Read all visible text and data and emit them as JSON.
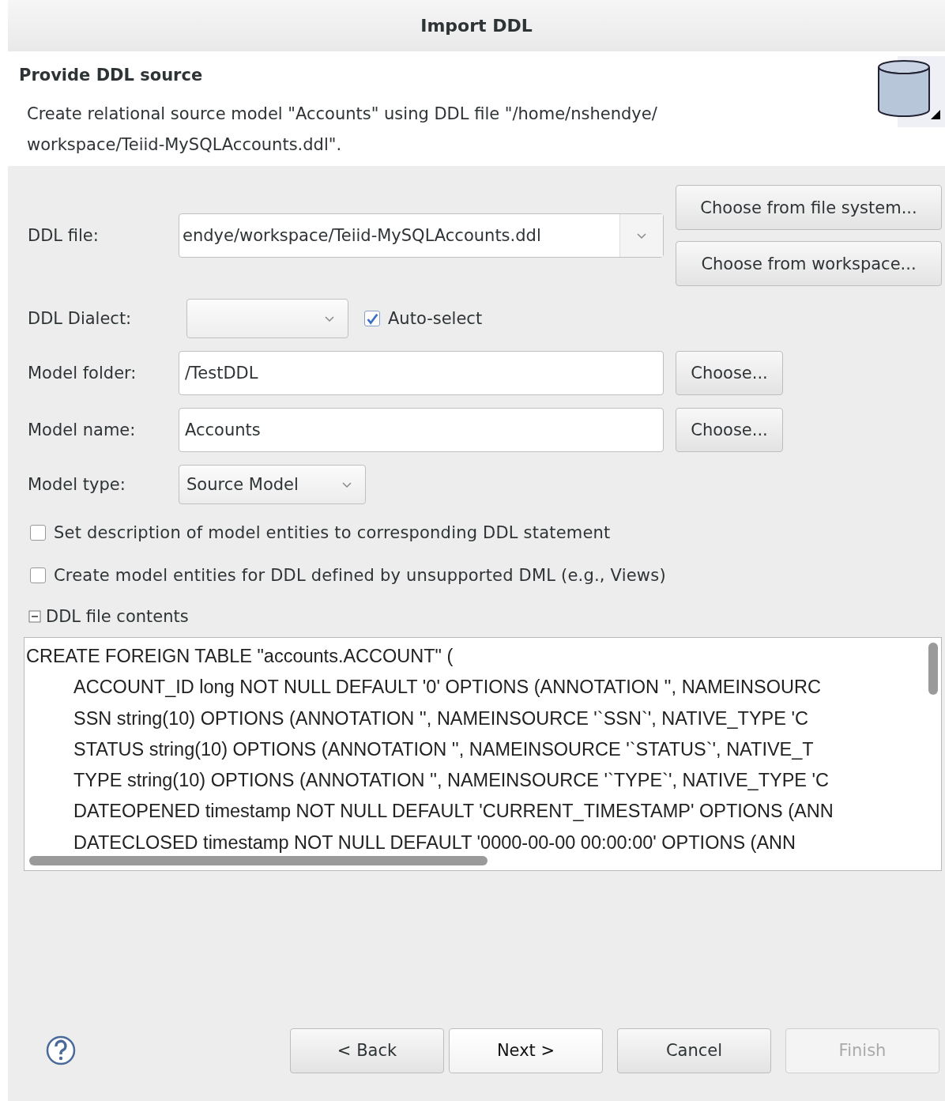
{
  "window": {
    "title": "Import DDL"
  },
  "header": {
    "title": "Provide DDL source",
    "description": "Create relational source model \"Accounts\" using DDL file \"/home/nshendye/ workspace/Teiid-MySQLAccounts.ddl\"."
  },
  "ddl_file": {
    "label": "DDL file:",
    "value": "endye/workspace/Teiid-MySQLAccounts.ddl",
    "buttons": [
      "Choose from file system...",
      "Choose from workspace..."
    ]
  },
  "ddl_dialect": {
    "label": "DDL Dialect:",
    "auto_select": {
      "label": "Auto-select",
      "checked": true
    }
  },
  "model_folder": {
    "label": "Model folder:",
    "value": "/TestDDL",
    "button": "Choose..."
  },
  "model_name": {
    "label": "Model name:",
    "value": "Accounts",
    "button": "Choose..."
  },
  "model_type": {
    "label": "Model type:",
    "value": "Source Model"
  },
  "options": [
    {
      "label": "Set description of model entities to corresponding DDL statement",
      "checked": false
    },
    {
      "label": "Create model entities for DDL defined by unsupported DML (e.g., Views)",
      "checked": false
    }
  ],
  "contents": {
    "label": "DDL file contents",
    "expanded": true,
    "lines": [
      {
        "text": "CREATE FOREIGN TABLE \"accounts.ACCOUNT\" (",
        "children": [
          {
            "text": "ACCOUNT_ID long NOT NULL DEFAULT '0' OPTIONS (ANNOTATION '', NAMEINSOURC"
          },
          {
            "text": "SSN string(10) OPTIONS (ANNOTATION '', NAMEINSOURCE '`SSN`', NATIVE_TYPE 'C"
          },
          {
            "text": "STATUS string(10) OPTIONS (ANNOTATION '', NAMEINSOURCE '`STATUS`', NATIVE_T"
          },
          {
            "text": "TYPE string(10) OPTIONS (ANNOTATION '', NAMEINSOURCE '`TYPE`', NATIVE_TYPE 'C"
          },
          {
            "text": "DATEOPENED timestamp NOT NULL DEFAULT 'CURRENT_TIMESTAMP' OPTIONS (ANN"
          },
          {
            "text": "DATECLOSED timestamp NOT NULL DEFAULT '0000-00-00 00:00:00' OPTIONS (ANN"
          }
        ]
      }
    ]
  },
  "buttons": [
    {
      "label": "< Back",
      "disabled": false,
      "default": false
    },
    {
      "label": "Next >",
      "disabled": false,
      "default": true
    },
    {
      "label": "Cancel",
      "disabled": false,
      "default": false
    },
    {
      "label": "Finish",
      "disabled": true,
      "default": false
    }
  ]
}
